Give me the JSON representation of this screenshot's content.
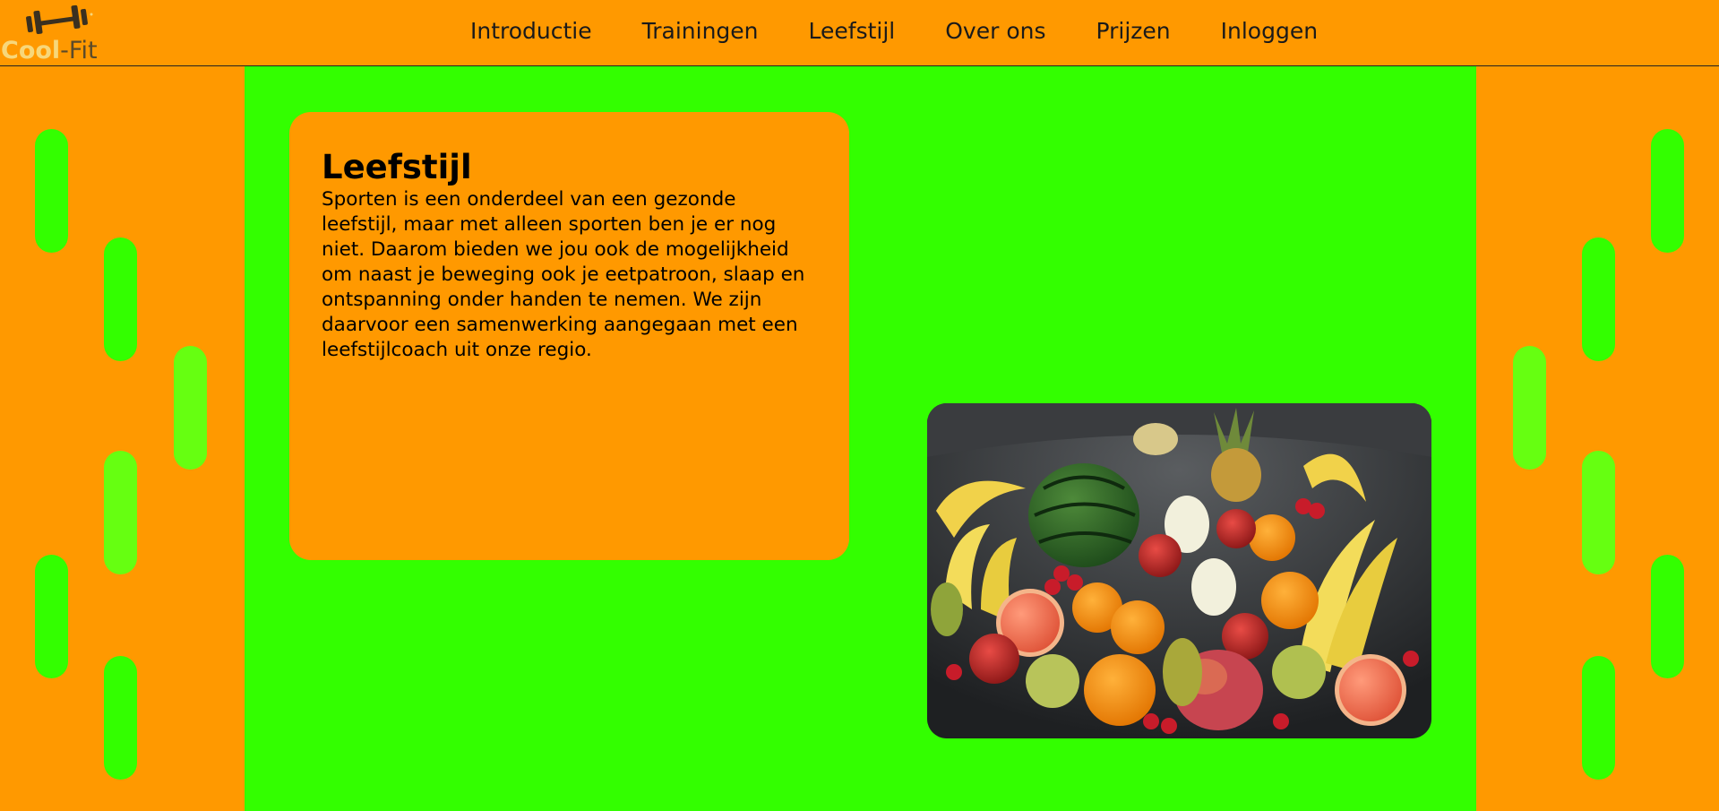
{
  "brand": {
    "name_part1": "Cool",
    "name_part2": "-Fit",
    "icon": "dumbbell-icon"
  },
  "nav": {
    "items": [
      "Introductie",
      "Trainingen",
      "Leefstijl",
      "Over ons",
      "Prijzen",
      "Inloggen"
    ]
  },
  "content": {
    "title": "Leefstijl",
    "body": "Sporten is een onderdeel van een gezonde leefstijl, maar met alleen sporten ben je er nog niet. Daarom bieden we jou ook de mogelijkheid om naast je beweging ook je eetpatroon, slaap en ontspanning onder handen te nemen. We zijn daarvoor een samenwerking aangegaan met een leefstijlcoach uit onze regio."
  },
  "image": {
    "subject": "fruit-arrangement-photo"
  },
  "colors": {
    "background": "#ff9900",
    "main": "#33ff00",
    "card": "#ff9900",
    "stripe_green": "#33ff00",
    "stripe_lime": "#66ff11"
  }
}
